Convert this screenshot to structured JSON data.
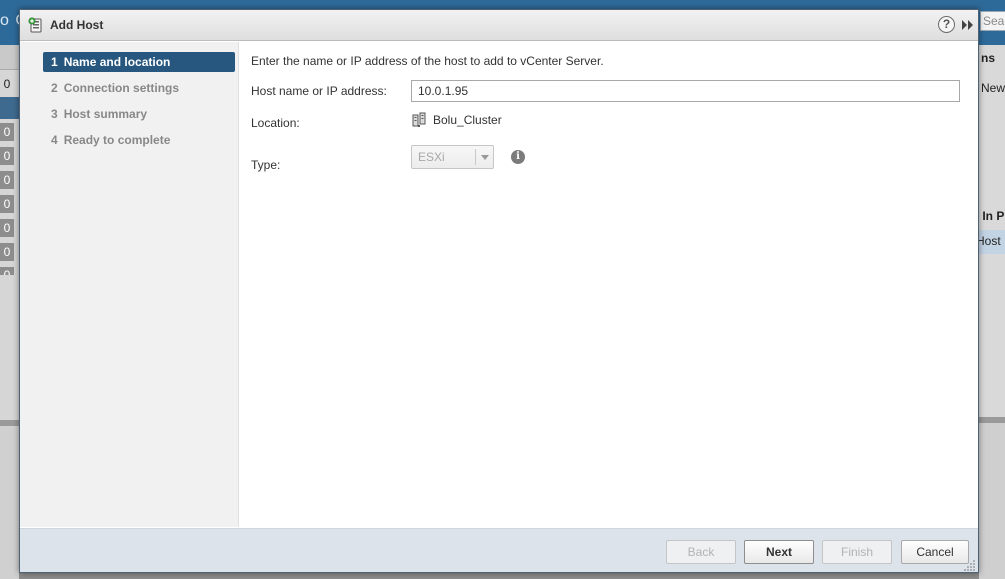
{
  "background": {
    "top_text": "o C",
    "search_placeholder": "Sea",
    "left_digits": [
      "0",
      "0",
      "0",
      "0",
      "0",
      "0",
      "0",
      "0"
    ],
    "right_texts": [
      "ns",
      "New",
      ": In P",
      "Host"
    ]
  },
  "dialog": {
    "title": "Add Host",
    "help_label": "?",
    "steps": [
      {
        "num": "1",
        "label": "Name and location",
        "active": true
      },
      {
        "num": "2",
        "label": "Connection settings",
        "active": false
      },
      {
        "num": "3",
        "label": "Host summary",
        "active": false
      },
      {
        "num": "4",
        "label": "Ready to complete",
        "active": false
      }
    ],
    "content": {
      "intro": "Enter the name or IP address of the host to add to vCenter Server.",
      "host_label": "Host name or IP address:",
      "host_value": "10.0.1.95",
      "location_label": "Location:",
      "location_value": "Bolu_Cluster",
      "type_label": "Type:",
      "type_value": "ESXi",
      "info_label": "i"
    },
    "buttons": {
      "back": "Back",
      "next": "Next",
      "finish": "Finish",
      "cancel": "Cancel"
    }
  },
  "colors": {
    "accent": "#27577f",
    "titlebar": "#e6e6e6",
    "footer": "#dde3ea",
    "steps_pane": "#f1f1f1"
  }
}
